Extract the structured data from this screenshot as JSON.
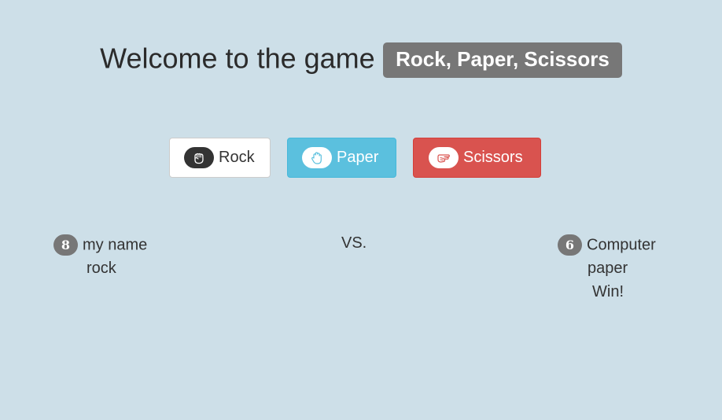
{
  "header": {
    "welcome_text": "Welcome to the game",
    "game_name": "Rock, Paper, Scissors"
  },
  "buttons": {
    "rock": {
      "label": "Rock",
      "icon": "hand-rock-icon"
    },
    "paper": {
      "label": "Paper",
      "icon": "hand-paper-icon"
    },
    "scissors": {
      "label": "Scissors",
      "icon": "hand-scissors-icon"
    }
  },
  "match": {
    "player": {
      "score": "8",
      "name": "my name",
      "choice": "rock"
    },
    "vs_text": "VS.",
    "computer": {
      "score": "6",
      "name": "Computer",
      "choice": "paper",
      "result": "Win!"
    }
  },
  "colors": {
    "background": "#cddfe8",
    "badge_gray": "#777777",
    "paper_button": "#5bc0de",
    "scissors_button": "#d9534f"
  }
}
